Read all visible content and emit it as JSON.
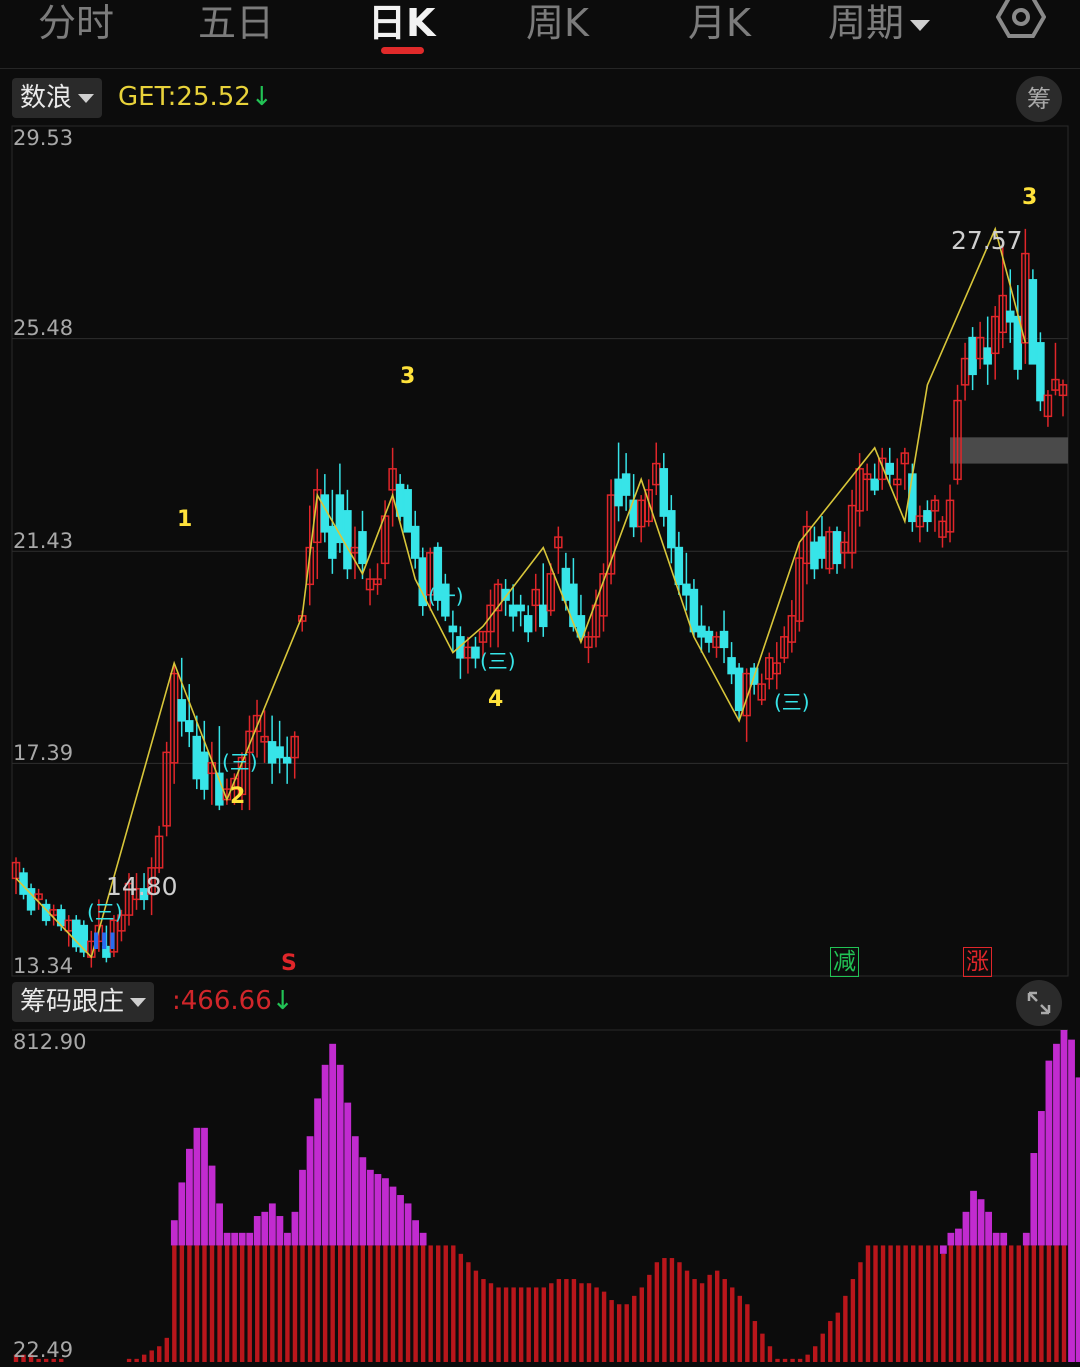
{
  "tabs": [
    {
      "label": "分时"
    },
    {
      "label": "五日"
    },
    {
      "label": "日K"
    },
    {
      "label": "周K"
    },
    {
      "label": "月K"
    },
    {
      "label": "周期"
    }
  ],
  "active_tab_index": 2,
  "icons": {
    "settings": "gear-icon",
    "chip": "筹",
    "expand": "expand-icon"
  },
  "colors": {
    "up": "#e0262a",
    "down": "#37e4e8",
    "line": "#d8c63a",
    "magenta": "#c12bcf",
    "bar_red": "#b9161b",
    "wave": "#ffe23b",
    "accent_tab": "#e02a2a"
  },
  "main_indicator": {
    "name": "数浪",
    "label": "GET:",
    "value": "25.52",
    "arrow": "↓"
  },
  "main_axis": {
    "top": "29.53",
    "mid1": "25.48",
    "mid2": "21.43",
    "mid3": "17.39",
    "bottom": "13.34"
  },
  "annotations": {
    "high": "27.57",
    "low": "14.80"
  },
  "wave_labels": [
    "1",
    "2",
    "3",
    "4",
    "3"
  ],
  "wave_marks": [
    "(三)",
    "(三)",
    "(一)",
    "(三)",
    "(三)"
  ],
  "signals": {
    "s": "S",
    "iii": "III",
    "reduce": "减",
    "rise": "涨"
  },
  "sub_indicator": {
    "name": "筹码跟庄",
    "label": ":",
    "value": "466.66",
    "arrow": "↓"
  },
  "sub_axis": {
    "top": "812.90",
    "bottom": "22.49"
  },
  "chart_data": {
    "type": "candlestick",
    "ylim": [
      13.34,
      29.53
    ],
    "candles": [
      [
        15.2,
        15.6,
        14.9,
        15.5
      ],
      [
        15.3,
        15.4,
        14.8,
        14.9
      ],
      [
        15.0,
        15.1,
        14.5,
        14.6
      ],
      [
        14.8,
        15.0,
        14.6,
        14.9
      ],
      [
        14.7,
        14.8,
        14.3,
        14.4
      ],
      [
        14.5,
        14.7,
        14.3,
        14.6
      ],
      [
        14.6,
        14.7,
        14.2,
        14.3
      ],
      [
        14.2,
        14.5,
        13.9,
        14.4
      ],
      [
        14.4,
        14.5,
        13.8,
        13.9
      ],
      [
        14.3,
        14.4,
        13.7,
        13.8
      ],
      [
        13.7,
        14.2,
        13.5,
        14.0
      ],
      [
        14.0,
        14.8,
        13.8,
        14.3
      ],
      [
        13.9,
        14.3,
        13.6,
        13.7
      ],
      [
        13.8,
        14.5,
        13.7,
        14.4
      ],
      [
        14.2,
        14.6,
        14.0,
        14.5
      ],
      [
        14.5,
        15.3,
        14.3,
        15.1
      ],
      [
        14.8,
        15.3,
        14.6,
        15.0
      ],
      [
        15.0,
        15.3,
        14.6,
        14.8
      ],
      [
        14.9,
        15.6,
        14.5,
        15.4
      ],
      [
        15.4,
        16.2,
        15.3,
        16.0
      ],
      [
        16.2,
        17.8,
        16.0,
        17.6
      ],
      [
        17.4,
        19.3,
        17.0,
        19.1
      ],
      [
        18.6,
        19.4,
        17.9,
        18.2
      ],
      [
        18.2,
        18.9,
        17.7,
        18.0
      ],
      [
        17.9,
        18.3,
        16.9,
        17.1
      ],
      [
        17.6,
        18.2,
        16.7,
        16.9
      ],
      [
        17.2,
        17.8,
        16.6,
        17.4
      ],
      [
        17.2,
        18.1,
        16.5,
        16.6
      ],
      [
        16.7,
        17.1,
        16.6,
        16.9
      ],
      [
        16.9,
        17.2,
        16.6,
        17.1
      ],
      [
        16.8,
        17.6,
        16.5,
        17.5
      ],
      [
        17.6,
        18.3,
        16.5,
        18.0
      ],
      [
        18.0,
        18.6,
        17.5,
        18.3
      ],
      [
        17.8,
        18.4,
        17.4,
        17.9
      ],
      [
        17.8,
        18.3,
        17.0,
        17.4
      ],
      [
        17.7,
        18.2,
        17.2,
        17.5
      ],
      [
        17.5,
        17.9,
        17.0,
        17.4
      ],
      [
        17.5,
        18.0,
        17.1,
        17.9
      ],
      [
        20.1,
        20.3,
        19.9,
        20.2
      ],
      [
        20.8,
        22.3,
        20.4,
        21.5
      ],
      [
        21.6,
        23.0,
        20.9,
        22.6
      ],
      [
        22.5,
        22.9,
        21.6,
        21.8
      ],
      [
        21.9,
        22.6,
        21.0,
        21.3
      ],
      [
        22.5,
        23.1,
        21.4,
        21.6
      ],
      [
        22.2,
        22.6,
        20.9,
        21.1
      ],
      [
        21.4,
        21.9,
        20.9,
        21.5
      ],
      [
        21.8,
        22.2,
        20.9,
        21.2
      ],
      [
        20.7,
        21.1,
        20.4,
        20.9
      ],
      [
        20.8,
        21.2,
        20.6,
        20.9
      ],
      [
        21.2,
        22.4,
        20.9,
        22.1
      ],
      [
        22.6,
        23.4,
        21.9,
        23.0
      ],
      [
        22.7,
        22.9,
        22.0,
        22.1
      ],
      [
        22.6,
        22.7,
        21.8,
        21.8
      ],
      [
        21.9,
        22.2,
        21.1,
        21.3
      ],
      [
        21.3,
        21.5,
        20.2,
        20.4
      ],
      [
        20.6,
        21.5,
        20.3,
        21.4
      ],
      [
        21.5,
        21.6,
        20.3,
        20.5
      ],
      [
        20.8,
        21.0,
        20.1,
        20.2
      ],
      [
        20.0,
        20.3,
        19.5,
        19.9
      ],
      [
        19.8,
        20.0,
        19.0,
        19.4
      ],
      [
        19.4,
        19.8,
        19.1,
        19.6
      ],
      [
        19.6,
        19.8,
        19.2,
        19.4
      ],
      [
        19.7,
        19.9,
        19.4,
        19.9
      ],
      [
        19.9,
        20.7,
        19.6,
        20.4
      ],
      [
        20.3,
        20.9,
        19.6,
        20.8
      ],
      [
        20.7,
        20.9,
        20.2,
        20.5
      ],
      [
        20.4,
        20.8,
        19.9,
        20.2
      ],
      [
        20.4,
        20.6,
        20.0,
        20.3
      ],
      [
        20.2,
        20.4,
        19.7,
        19.9
      ],
      [
        20.4,
        21.0,
        19.9,
        20.7
      ],
      [
        20.4,
        21.2,
        19.8,
        20.0
      ],
      [
        20.3,
        21.2,
        20.2,
        21.0
      ],
      [
        21.5,
        21.9,
        21.0,
        21.7
      ],
      [
        21.1,
        21.4,
        20.3,
        20.5
      ],
      [
        20.8,
        21.3,
        19.9,
        20.0
      ],
      [
        20.2,
        20.6,
        19.7,
        19.8
      ],
      [
        19.6,
        19.9,
        19.3,
        19.8
      ],
      [
        19.8,
        20.7,
        19.6,
        20.4
      ],
      [
        20.2,
        21.2,
        19.9,
        21.0
      ],
      [
        21.0,
        22.8,
        20.8,
        22.5
      ],
      [
        22.8,
        23.5,
        22.0,
        22.3
      ],
      [
        22.9,
        23.3,
        22.2,
        22.5
      ],
      [
        22.4,
        22.9,
        21.7,
        21.9
      ],
      [
        21.9,
        22.5,
        21.6,
        22.4
      ],
      [
        22.0,
        22.8,
        21.9,
        22.6
      ],
      [
        22.7,
        23.5,
        22.5,
        23.1
      ],
      [
        23.0,
        23.3,
        21.9,
        22.1
      ],
      [
        22.2,
        22.5,
        21.2,
        21.5
      ],
      [
        21.5,
        21.8,
        20.6,
        20.8
      ],
      [
        20.8,
        21.4,
        20.3,
        20.6
      ],
      [
        20.7,
        20.9,
        19.8,
        19.9
      ],
      [
        20.0,
        20.4,
        19.5,
        19.8
      ],
      [
        19.9,
        20.0,
        19.5,
        19.7
      ],
      [
        19.6,
        19.9,
        19.4,
        19.8
      ],
      [
        19.9,
        20.3,
        19.3,
        19.6
      ],
      [
        19.4,
        19.7,
        18.9,
        19.1
      ],
      [
        19.2,
        19.3,
        18.2,
        18.4
      ],
      [
        18.3,
        19.2,
        17.8,
        19.1
      ],
      [
        19.2,
        19.3,
        18.7,
        18.9
      ],
      [
        18.6,
        19.1,
        18.5,
        18.9
      ],
      [
        19.0,
        19.5,
        18.8,
        19.4
      ],
      [
        19.1,
        19.7,
        18.8,
        19.3
      ],
      [
        19.4,
        20.0,
        19.3,
        19.8
      ],
      [
        19.7,
        20.5,
        19.5,
        20.2
      ],
      [
        20.1,
        21.6,
        19.9,
        21.3
      ],
      [
        21.2,
        22.2,
        20.8,
        21.9
      ],
      [
        21.6,
        21.9,
        20.9,
        21.1
      ],
      [
        21.7,
        22.1,
        21.1,
        21.3
      ],
      [
        21.1,
        21.9,
        21.0,
        21.8
      ],
      [
        21.8,
        21.9,
        21.0,
        21.2
      ],
      [
        21.4,
        21.8,
        21.1,
        21.6
      ],
      [
        21.4,
        22.6,
        21.1,
        22.3
      ],
      [
        22.2,
        23.3,
        21.9,
        23.0
      ],
      [
        22.8,
        23.1,
        22.2,
        22.9
      ],
      [
        22.8,
        23.1,
        22.5,
        22.6
      ],
      [
        22.8,
        23.4,
        22.6,
        23.2
      ],
      [
        23.1,
        23.4,
        22.7,
        22.9
      ],
      [
        22.7,
        23.2,
        22.4,
        22.8
      ],
      [
        23.1,
        23.4,
        22.6,
        23.3
      ],
      [
        22.9,
        23.1,
        21.8,
        22.0
      ],
      [
        21.9,
        22.3,
        21.6,
        22.1
      ],
      [
        22.2,
        22.4,
        21.8,
        22.0
      ],
      [
        22.2,
        22.5,
        21.8,
        22.4
      ],
      [
        21.7,
        22.1,
        21.5,
        22.0
      ],
      [
        21.8,
        22.7,
        21.6,
        22.4
      ],
      [
        22.8,
        24.6,
        22.7,
        24.3
      ],
      [
        24.6,
        25.4,
        24.3,
        25.1
      ],
      [
        25.5,
        25.7,
        24.5,
        24.8
      ],
      [
        25.1,
        25.8,
        24.9,
        25.5
      ],
      [
        25.3,
        25.9,
        24.6,
        25.0
      ],
      [
        25.2,
        26.1,
        24.7,
        25.9
      ],
      [
        25.6,
        27.3,
        25.3,
        26.3
      ],
      [
        26.0,
        26.8,
        25.4,
        25.8
      ],
      [
        25.9,
        26.5,
        24.7,
        24.9
      ],
      [
        25.4,
        27.57,
        25.0,
        27.1
      ],
      [
        26.6,
        26.8,
        25.0,
        25.0
      ],
      [
        25.4,
        25.6,
        24.1,
        24.3
      ],
      [
        24.0,
        24.5,
        23.8,
        24.4
      ],
      [
        24.5,
        25.4,
        24.4,
        24.7
      ],
      [
        24.4,
        24.7,
        24.0,
        24.6
      ]
    ],
    "wave_points": [
      [
        0,
        15.2
      ],
      [
        10,
        13.7
      ],
      [
        21,
        19.3
      ],
      [
        28,
        16.7
      ],
      [
        38,
        20.2
      ],
      [
        40,
        22.5
      ],
      [
        46,
        21.0
      ],
      [
        50,
        22.5
      ],
      [
        53,
        20.9
      ],
      [
        58,
        19.5
      ],
      [
        62,
        20.0
      ],
      [
        70,
        21.5
      ],
      [
        75,
        19.7
      ],
      [
        83,
        22.8
      ],
      [
        90,
        19.8
      ],
      [
        96,
        18.2
      ],
      [
        104,
        21.6
      ],
      [
        114,
        23.4
      ],
      [
        118,
        22.0
      ],
      [
        121,
        24.6
      ],
      [
        130,
        27.57
      ],
      [
        134,
        25.4
      ]
    ],
    "chip_range": [
      23.1,
      23.6
    ],
    "sub_ylim": [
      22.49,
      812.9
    ],
    "magenta": [
      0,
      0,
      0,
      0,
      0,
      0,
      0,
      0,
      0,
      0,
      0,
      0,
      0,
      0,
      0,
      0,
      0,
      0,
      0,
      0,
      0,
      360,
      450,
      530,
      580,
      580,
      490,
      400,
      330,
      330,
      330,
      330,
      370,
      380,
      400,
      370,
      330,
      380,
      480,
      560,
      650,
      730,
      780,
      730,
      640,
      560,
      510,
      480,
      470,
      460,
      440,
      420,
      400,
      360,
      330,
      300,
      0,
      0,
      0,
      0,
      0,
      0,
      0,
      0,
      0,
      0,
      0,
      0,
      0,
      0,
      0,
      0,
      0,
      0,
      0,
      0,
      0,
      0,
      0,
      0,
      0,
      0,
      0,
      0,
      0,
      0,
      0,
      0,
      0,
      0,
      0,
      0,
      0,
      0,
      0,
      0,
      0,
      0,
      0,
      0,
      0,
      0,
      0,
      0,
      0,
      0,
      0,
      0,
      0,
      0,
      0,
      0,
      0,
      0,
      0,
      0,
      0,
      0,
      0,
      0,
      0,
      0,
      0,
      300,
      330,
      340,
      380,
      430,
      410,
      380,
      330,
      330,
      300,
      0,
      330,
      520,
      620,
      740,
      780,
      812.9,
      790,
      700,
      620,
      560
    ],
    "red": [
      40,
      40,
      40,
      30,
      30,
      30,
      30,
      20,
      20,
      20,
      20,
      20,
      20,
      20,
      20,
      30,
      30,
      40,
      50,
      60,
      80,
      300,
      300,
      300,
      300,
      300,
      300,
      300,
      300,
      300,
      300,
      300,
      300,
      300,
      300,
      300,
      300,
      300,
      300,
      300,
      300,
      300,
      300,
      300,
      300,
      300,
      300,
      300,
      300,
      300,
      300,
      300,
      300,
      300,
      300,
      300,
      300,
      300,
      300,
      280,
      260,
      240,
      220,
      210,
      200,
      200,
      200,
      200,
      200,
      200,
      200,
      210,
      220,
      220,
      220,
      210,
      210,
      200,
      190,
      170,
      160,
      160,
      180,
      200,
      230,
      260,
      270,
      270,
      260,
      240,
      220,
      210,
      230,
      240,
      220,
      200,
      180,
      160,
      120,
      90,
      60,
      30,
      30,
      30,
      30,
      40,
      60,
      90,
      120,
      140,
      180,
      220,
      260,
      300,
      300,
      300,
      300,
      300,
      300,
      300,
      300,
      300,
      300,
      280,
      300,
      300,
      300,
      300,
      300,
      300,
      300,
      300,
      300,
      300,
      300,
      300,
      300,
      300,
      300,
      300
    ]
  }
}
